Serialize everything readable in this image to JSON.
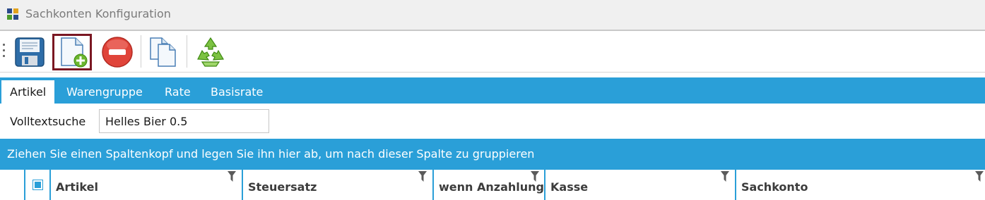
{
  "window": {
    "title": "Sachkonten Konfiguration"
  },
  "toolbar": {
    "buttons": [
      {
        "icon": "floppy-save-icon",
        "selected": false
      },
      {
        "icon": "new-document-plus-icon",
        "selected": true
      },
      {
        "icon": "red-minus-delete-icon",
        "selected": false
      },
      {
        "icon": "copy-documents-icon",
        "selected": false
      },
      {
        "icon": "recycle-icon",
        "selected": false
      }
    ]
  },
  "tabs": [
    {
      "label": "Artikel",
      "active": true
    },
    {
      "label": "Warengruppe",
      "active": false
    },
    {
      "label": "Rate",
      "active": false
    },
    {
      "label": "Basisrate",
      "active": false
    }
  ],
  "search": {
    "label": "Volltextsuche",
    "value": "Helles Bier 0.5"
  },
  "group_panel": {
    "text": "Ziehen Sie einen Spaltenkopf und legen Sie ihn hier ab, um nach dieser Spalte zu gruppieren"
  },
  "grid": {
    "columns": [
      {
        "label": "Artikel"
      },
      {
        "label": "Steuersatz"
      },
      {
        "label": "wenn Anzahlung"
      },
      {
        "label": "Kasse"
      },
      {
        "label": "Sachkonto"
      }
    ]
  },
  "colors": {
    "accent": "#2a9fd8",
    "selected_border": "#7a1722",
    "title_text": "#7a7a7a"
  }
}
